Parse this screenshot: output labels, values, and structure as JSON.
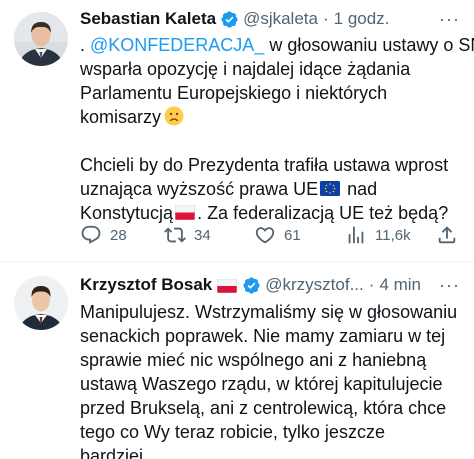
{
  "tweets": [
    {
      "name": "Sebastian Kaleta",
      "handle": "@sjkaleta",
      "dot": "·",
      "time": "1 godz.",
      "more": "···",
      "lines": [
        {
          "pre": ". ",
          "mention": "@KONFEDERACJA_",
          "post": " w głosowaniu ustawy o SN"
        },
        "wsparła opozycję i najdalej idące żądania",
        "Parlamentu Europejskiego i niektórych",
        {
          "text": "komisarzy",
          "emoji": "slightly-frowning-face"
        },
        "",
        "Chcieli by do Prezydenta trafiła ustawa wprost",
        {
          "text": "uznająca wyższość prawa UE",
          "emoji": "eu-flag",
          "post": " nad"
        },
        {
          "text": "Konstytucją",
          "emoji": "poland-flag",
          "post": ". Za federalizacją UE też będą?"
        }
      ],
      "actions": {
        "replies": "28",
        "retweets": "34",
        "likes": "61",
        "views": "11,6k"
      }
    },
    {
      "name": "Krzysztof Bosak",
      "name_flag": "poland-flag",
      "handle": "@krzysztof...",
      "dot": "·",
      "time": "4 min",
      "more": "···",
      "lines": [
        "Manipulujesz. Wstrzymaliśmy się w głosowaniu",
        "senackich poprawek. Nie mamy zamiaru w tej",
        "sprawie mieć nic wspólnego ani z haniebną",
        "ustawą Waszego rządu, w której kapitulujecie",
        "przed Brukselą, ani z centrolewicą, która chce",
        "tego co Wy teraz robicie, tylko jeszcze",
        "bardziej."
      ]
    }
  ],
  "icons": {
    "verified": "verified-badge-icon",
    "reply": "reply-icon",
    "retweet": "retweet-icon",
    "like": "heart-icon",
    "views": "views-icon",
    "share": "share-icon"
  },
  "colors": {
    "text": "#0f1419",
    "secondary": "#536471",
    "link": "#1d9bf0",
    "verified": "#1d9bf0",
    "divider": "#eff3f4"
  }
}
